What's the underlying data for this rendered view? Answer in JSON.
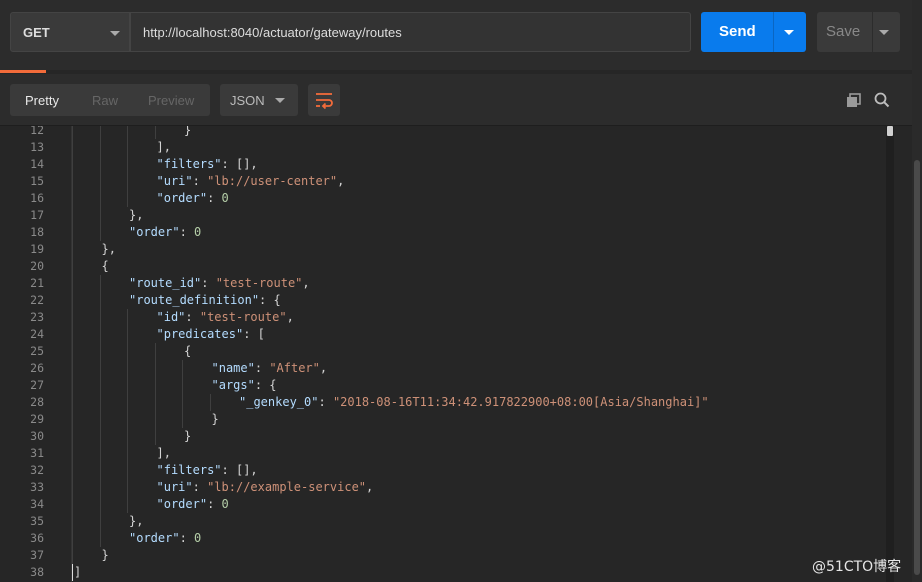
{
  "request": {
    "method": "GET",
    "url": "http://localhost:8040/actuator/gateway/routes",
    "send_label": "Send",
    "save_label": "Save"
  },
  "response_toolbar": {
    "views": [
      "Pretty",
      "Raw",
      "Preview"
    ],
    "active_view": "Pretty",
    "format": "JSON",
    "icons": [
      "wrap-lines-icon",
      "copy-icon",
      "search-icon"
    ]
  },
  "colors": {
    "accent_blue": "#097bed",
    "accent_orange": "#f26b3a",
    "background": "#262626"
  },
  "code": {
    "lines": [
      {
        "n": "12",
        "indent": 4,
        "tokens": [
          [
            "p",
            "}"
          ]
        ]
      },
      {
        "n": "13",
        "indent": 3,
        "tokens": [
          [
            "p",
            "],"
          ]
        ]
      },
      {
        "n": "14",
        "indent": 3,
        "tokens": [
          [
            "k",
            "\"filters\""
          ],
          [
            "p",
            ": [],"
          ]
        ]
      },
      {
        "n": "15",
        "indent": 3,
        "tokens": [
          [
            "k",
            "\"uri\""
          ],
          [
            "p",
            ": "
          ],
          [
            "s",
            "\"lb://user-center\""
          ],
          [
            "p",
            ","
          ]
        ]
      },
      {
        "n": "16",
        "indent": 3,
        "tokens": [
          [
            "k",
            "\"order\""
          ],
          [
            "p",
            ": "
          ],
          [
            "n",
            "0"
          ]
        ]
      },
      {
        "n": "17",
        "indent": 2,
        "tokens": [
          [
            "p",
            "},"
          ]
        ]
      },
      {
        "n": "18",
        "indent": 2,
        "tokens": [
          [
            "k",
            "\"order\""
          ],
          [
            "p",
            ": "
          ],
          [
            "n",
            "0"
          ]
        ]
      },
      {
        "n": "19",
        "indent": 1,
        "tokens": [
          [
            "p",
            "},"
          ]
        ]
      },
      {
        "n": "20",
        "indent": 1,
        "tokens": [
          [
            "p",
            "{"
          ]
        ]
      },
      {
        "n": "21",
        "indent": 2,
        "tokens": [
          [
            "k",
            "\"route_id\""
          ],
          [
            "p",
            ": "
          ],
          [
            "s",
            "\"test-route\""
          ],
          [
            "p",
            ","
          ]
        ]
      },
      {
        "n": "22",
        "indent": 2,
        "tokens": [
          [
            "k",
            "\"route_definition\""
          ],
          [
            "p",
            ": {"
          ]
        ]
      },
      {
        "n": "23",
        "indent": 3,
        "tokens": [
          [
            "k",
            "\"id\""
          ],
          [
            "p",
            ": "
          ],
          [
            "s",
            "\"test-route\""
          ],
          [
            "p",
            ","
          ]
        ]
      },
      {
        "n": "24",
        "indent": 3,
        "tokens": [
          [
            "k",
            "\"predicates\""
          ],
          [
            "p",
            ": ["
          ]
        ]
      },
      {
        "n": "25",
        "indent": 4,
        "tokens": [
          [
            "p",
            "{"
          ]
        ]
      },
      {
        "n": "26",
        "indent": 5,
        "tokens": [
          [
            "k",
            "\"name\""
          ],
          [
            "p",
            ": "
          ],
          [
            "s",
            "\"After\""
          ],
          [
            "p",
            ","
          ]
        ]
      },
      {
        "n": "27",
        "indent": 5,
        "tokens": [
          [
            "k",
            "\"args\""
          ],
          [
            "p",
            ": {"
          ]
        ]
      },
      {
        "n": "28",
        "indent": 6,
        "tokens": [
          [
            "k",
            "\"_genkey_0\""
          ],
          [
            "p",
            ": "
          ],
          [
            "s",
            "\"2018-08-16T11:34:42.917822900+08:00[Asia/Shanghai]\""
          ]
        ]
      },
      {
        "n": "29",
        "indent": 5,
        "tokens": [
          [
            "p",
            "}"
          ]
        ]
      },
      {
        "n": "30",
        "indent": 4,
        "tokens": [
          [
            "p",
            "}"
          ]
        ]
      },
      {
        "n": "31",
        "indent": 3,
        "tokens": [
          [
            "p",
            "],"
          ]
        ]
      },
      {
        "n": "32",
        "indent": 3,
        "tokens": [
          [
            "k",
            "\"filters\""
          ],
          [
            "p",
            ": [],"
          ]
        ]
      },
      {
        "n": "33",
        "indent": 3,
        "tokens": [
          [
            "k",
            "\"uri\""
          ],
          [
            "p",
            ": "
          ],
          [
            "s",
            "\"lb://example-service\""
          ],
          [
            "p",
            ","
          ]
        ]
      },
      {
        "n": "34",
        "indent": 3,
        "tokens": [
          [
            "k",
            "\"order\""
          ],
          [
            "p",
            ": "
          ],
          [
            "n",
            "0"
          ]
        ]
      },
      {
        "n": "35",
        "indent": 2,
        "tokens": [
          [
            "p",
            "},"
          ]
        ]
      },
      {
        "n": "36",
        "indent": 2,
        "tokens": [
          [
            "k",
            "\"order\""
          ],
          [
            "p",
            ": "
          ],
          [
            "n",
            "0"
          ]
        ]
      },
      {
        "n": "37",
        "indent": 1,
        "tokens": [
          [
            "p",
            "}"
          ]
        ]
      },
      {
        "n": "38",
        "indent": 0,
        "tokens": [
          [
            "p",
            "]"
          ]
        ]
      }
    ]
  },
  "watermark": "@51CTO博客"
}
